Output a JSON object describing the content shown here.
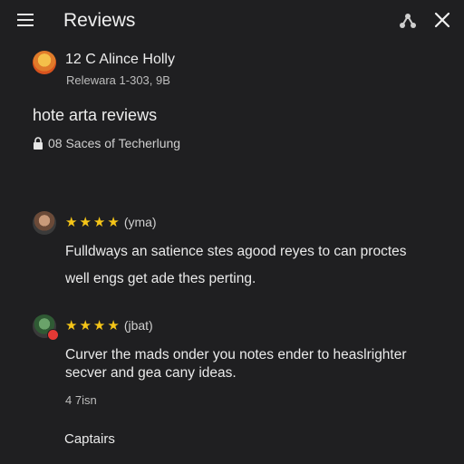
{
  "header": {
    "title": "Reviews",
    "menu_icon": "menu-icon",
    "share_icon": "share-icon",
    "close_icon": "close-icon"
  },
  "place": {
    "name": "12 C Alince Holly",
    "subtitle": "Relewara 1-303, 9B"
  },
  "section": {
    "title": "hote arta reviews",
    "subtitle": "08 Saces of Techerlung"
  },
  "reviews": [
    {
      "stars": 4,
      "rating_label": "(yma)",
      "lines": [
        "Fulldways an satience stes agood reyes to can proctes",
        "well engs get ade thes perting."
      ]
    },
    {
      "stars": 4,
      "rating_label": "(jbat)",
      "lines": [
        "Curver the mads onder you notes ender to heaslrighter",
        "secver and gea cany ideas."
      ],
      "meta": "4 7isn"
    }
  ],
  "footer": {
    "link": "Captairs"
  },
  "colors": {
    "background": "#1f1f21",
    "star": "#f5c518",
    "text": "#eaeaea",
    "muted": "#bdbdbd"
  }
}
